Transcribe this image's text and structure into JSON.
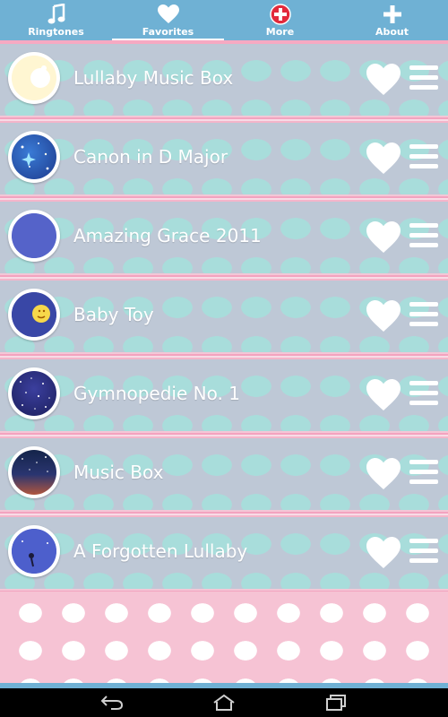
{
  "tabs": [
    {
      "label": "Ringtones",
      "icon": "music-note-icon"
    },
    {
      "label": "Favorites",
      "icon": "heart-icon"
    },
    {
      "label": "More",
      "icon": "plus-circle-icon"
    },
    {
      "label": "About",
      "icon": "plus-icon"
    }
  ],
  "active_tab": "Favorites",
  "songs": [
    {
      "title": "Lullaby Music Box",
      "icon": "sleeping-moon-icon"
    },
    {
      "title": "Canon in D Major",
      "icon": "starry-sky-icon"
    },
    {
      "title": "Amazing Grace 2011",
      "icon": "crescent-moon-icon"
    },
    {
      "title": "Baby Toy",
      "icon": "smiling-moon-icon"
    },
    {
      "title": "Gymnopedie No. 1",
      "icon": "night-sky-icon"
    },
    {
      "title": "Music Box",
      "icon": "dusk-sky-icon"
    },
    {
      "title": "A Forgotten Lullaby",
      "icon": "moon-fairy-icon"
    }
  ],
  "colors": {
    "tab_bar": "#6fb1d4",
    "row_background": "#bec8d6",
    "row_dots": "#a8dddb",
    "separator": "#f3a3bf",
    "pink_background": "#f6c3d4"
  },
  "nav": [
    "back-icon",
    "home-icon",
    "recent-apps-icon"
  ]
}
